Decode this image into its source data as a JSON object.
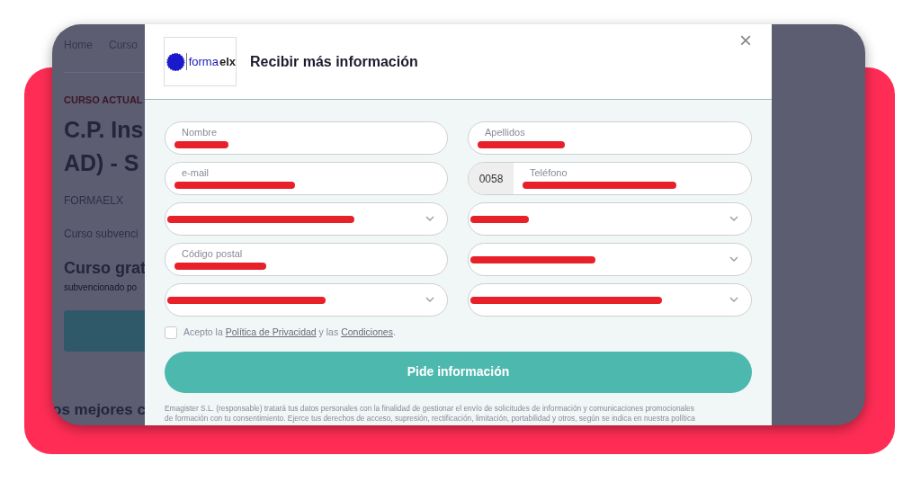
{
  "background_page": {
    "nav": [
      "Home",
      "Curso"
    ],
    "eyebrow": "CURSO ACTUAL",
    "title_lines": [
      "C.P. Ins",
      "AD) - S"
    ],
    "provider": "FORMAELX",
    "subtitle": "Curso subvenci",
    "price_heading": "Curso grat",
    "price_note": "subvencionado po",
    "section_heading": "os mejores c"
  },
  "modal": {
    "logo": {
      "prefix": "forma",
      "suffix": "elx"
    },
    "title": "Recibir más información",
    "close": "×",
    "fields": [
      {
        "kind": "text",
        "label": "Nombre",
        "redacted": true
      },
      {
        "kind": "text",
        "label": "Apellidos",
        "redacted": true
      },
      {
        "kind": "text",
        "label": "e-mail",
        "redacted": true
      },
      {
        "kind": "phone",
        "label": "Teléfono",
        "prefix": "0058",
        "redacted": true
      },
      {
        "kind": "select",
        "redacted": true
      },
      {
        "kind": "select",
        "redacted": true
      },
      {
        "kind": "text",
        "label": "Código postal",
        "redacted": true
      },
      {
        "kind": "select",
        "redacted": true
      },
      {
        "kind": "select",
        "redacted": true
      },
      {
        "kind": "select",
        "redacted": true
      }
    ],
    "consent": {
      "checked": false,
      "parts": [
        {
          "kind": "text",
          "text": "Acepto la "
        },
        {
          "kind": "link",
          "text": "Política de Privacidad"
        },
        {
          "kind": "text",
          "text": " y las "
        },
        {
          "kind": "link",
          "text": "Condiciones"
        },
        {
          "kind": "text",
          "text": "."
        }
      ]
    },
    "submit": "Pide información",
    "disclaimer": [
      "Emagister S.L. (responsable) tratará tus datos personales con la finalidad de gestionar el envío de solicitudes de información y comunicaciones promocionales",
      "de formación con tu consentimiento. Ejerce tus derechos de acceso, supresión, rectificación, limitación, portabilidad y otros, según se indica en nuestra política"
    ]
  }
}
